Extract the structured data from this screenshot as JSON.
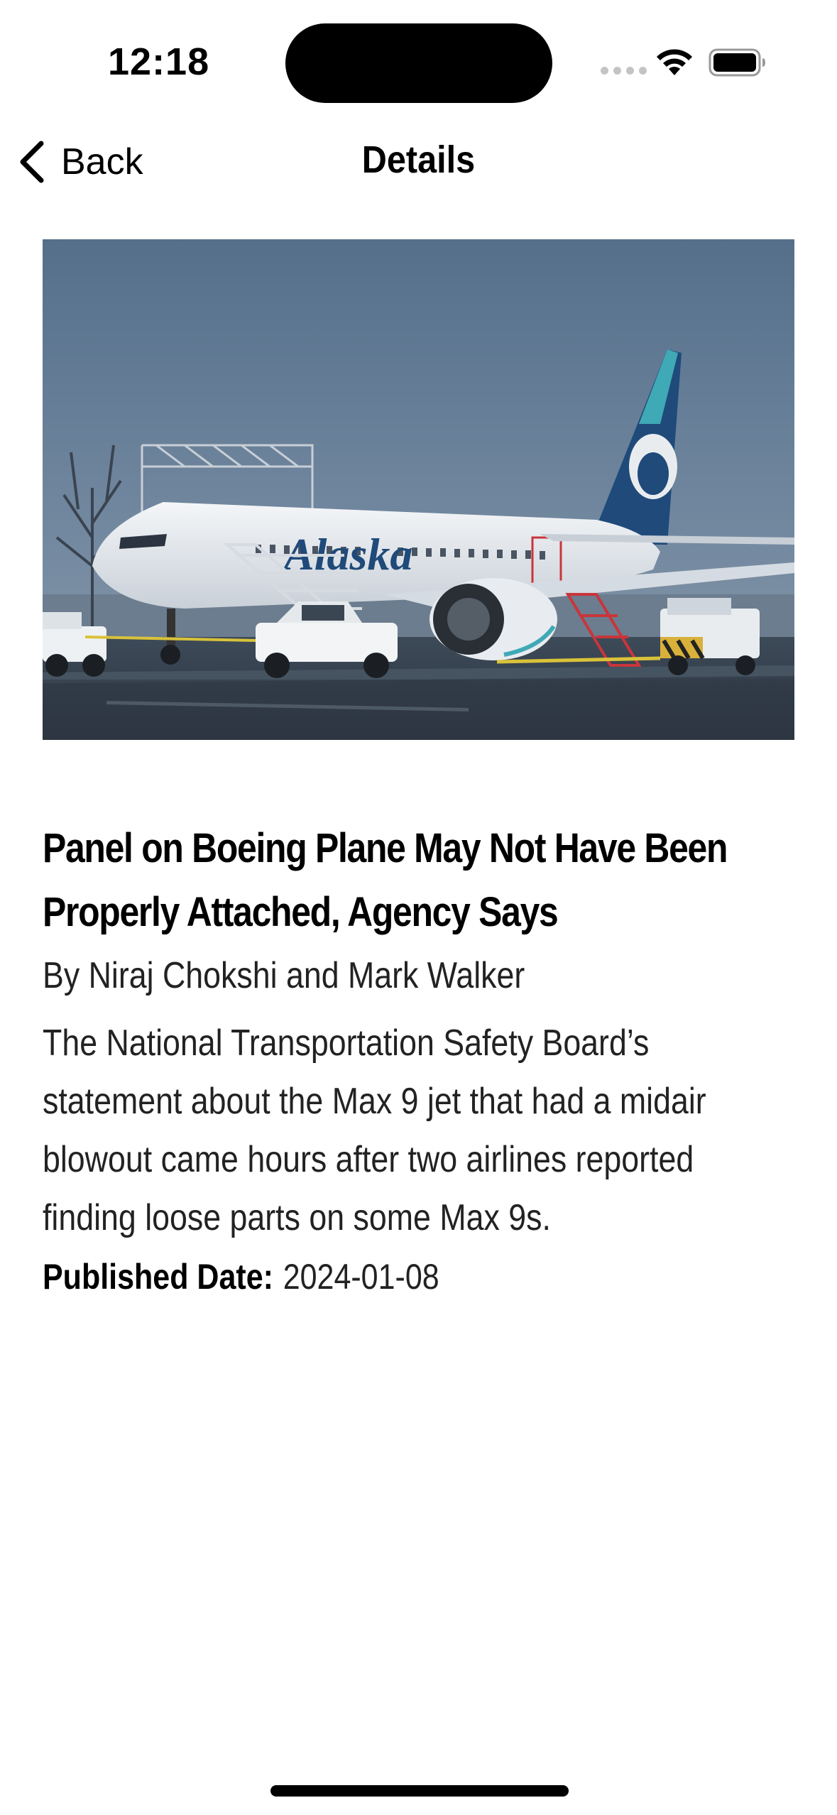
{
  "status_bar": {
    "time": "12:18",
    "icons": [
      "signal-dots-icon",
      "wifi-icon",
      "battery-icon"
    ]
  },
  "nav": {
    "back_label": "Back",
    "title": "Details"
  },
  "article": {
    "image_description": "Alaska Airlines Boeing 737 Max 9 parked on wet tarmac",
    "image_logo_text": "Alaska",
    "headline": "Panel on Boeing Plane May Not Have Been Properly Attached, Agency Says",
    "byline": "By Niraj Chokshi and Mark Walker",
    "abstract": "The National Transportation Safety Board’s statement about the Max 9 jet that had a midair blowout came hours after two airlines reported finding loose parts on some Max 9s.",
    "published_label": "Published Date:",
    "published_date": "2024-01-08"
  },
  "colors": {
    "background": "#ffffff",
    "text": "#000000",
    "sky": "#5f7891",
    "tail": "#1f4a7a",
    "accent_teal": "#3fa9b5"
  }
}
